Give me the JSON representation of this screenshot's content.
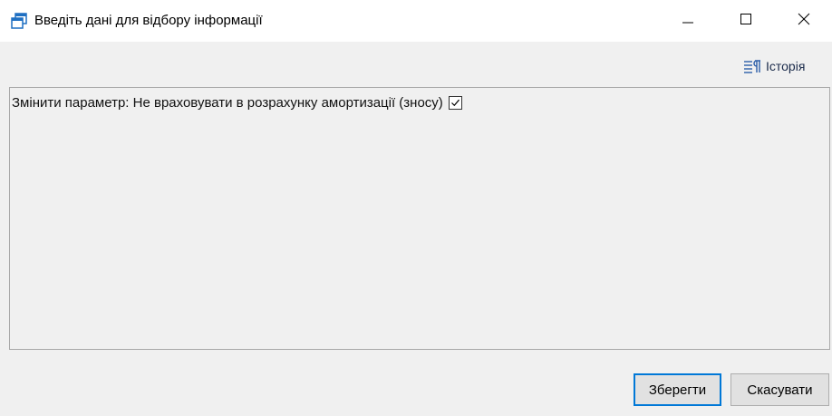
{
  "window": {
    "title": "Введіть дані для відбору інформації",
    "controls": {
      "minimize_icon": "minimize-icon",
      "maximize_icon": "maximize-icon",
      "close_icon": "close-icon"
    }
  },
  "toolbar": {
    "history_label": "Історія",
    "history_icon": "history-icon"
  },
  "form": {
    "param_label": "Змінити параметр: Не враховувати в розрахунку амортизації (зносу)",
    "param_checked": true
  },
  "buttons": {
    "save_label": "Зберегти",
    "cancel_label": "Скасувати"
  },
  "colors": {
    "accent": "#0078d7",
    "body_bg": "#f0f0f0",
    "app_icon": "#1e6fc2"
  }
}
